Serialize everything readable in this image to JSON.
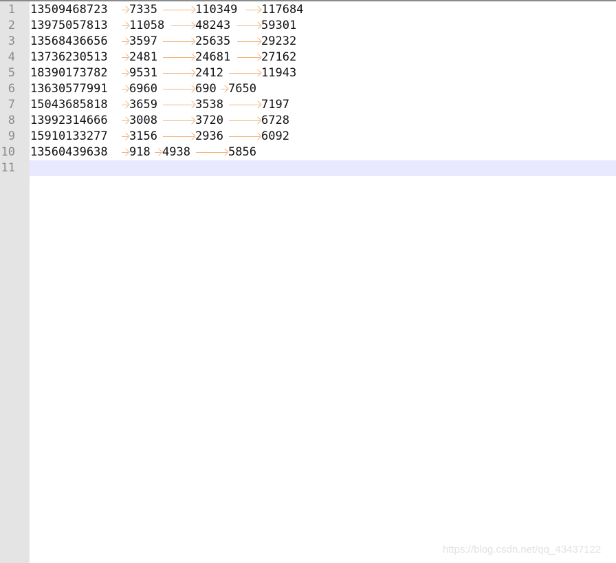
{
  "editor": {
    "line_numbers": [
      "1",
      "2",
      "3",
      "4",
      "5",
      "6",
      "7",
      "8",
      "9",
      "10",
      "11"
    ],
    "current_line": "11",
    "colors": {
      "gutter_bg": "#e4e4e4",
      "gutter_text": "#8b8b8b",
      "current_line_bg": "#e8e8ff",
      "tab_arrow": "#f3b37a",
      "text": "#111111"
    },
    "lines": [
      [
        "13509468723",
        "7335",
        "110349",
        "117684"
      ],
      [
        "13975057813",
        "11058",
        "48243",
        "59301"
      ],
      [
        "13568436656",
        "3597",
        "25635",
        "29232"
      ],
      [
        "13736230513",
        "2481",
        "24681",
        "27162"
      ],
      [
        "18390173782",
        "9531",
        "2412",
        "11943"
      ],
      [
        "13630577991",
        "6960",
        "690",
        "7650"
      ],
      [
        "15043685818",
        "3659",
        "3538",
        "7197"
      ],
      [
        "13992314666",
        "3008",
        "3720",
        "6728"
      ],
      [
        "15910133277",
        "3156",
        "2936",
        "6092"
      ],
      [
        "13560439638",
        "918",
        "4938",
        "5856"
      ]
    ],
    "separator_icon": "tab-arrow-icon"
  },
  "watermark": {
    "text": "https://blog.csdn.net/qq_43437122"
  }
}
